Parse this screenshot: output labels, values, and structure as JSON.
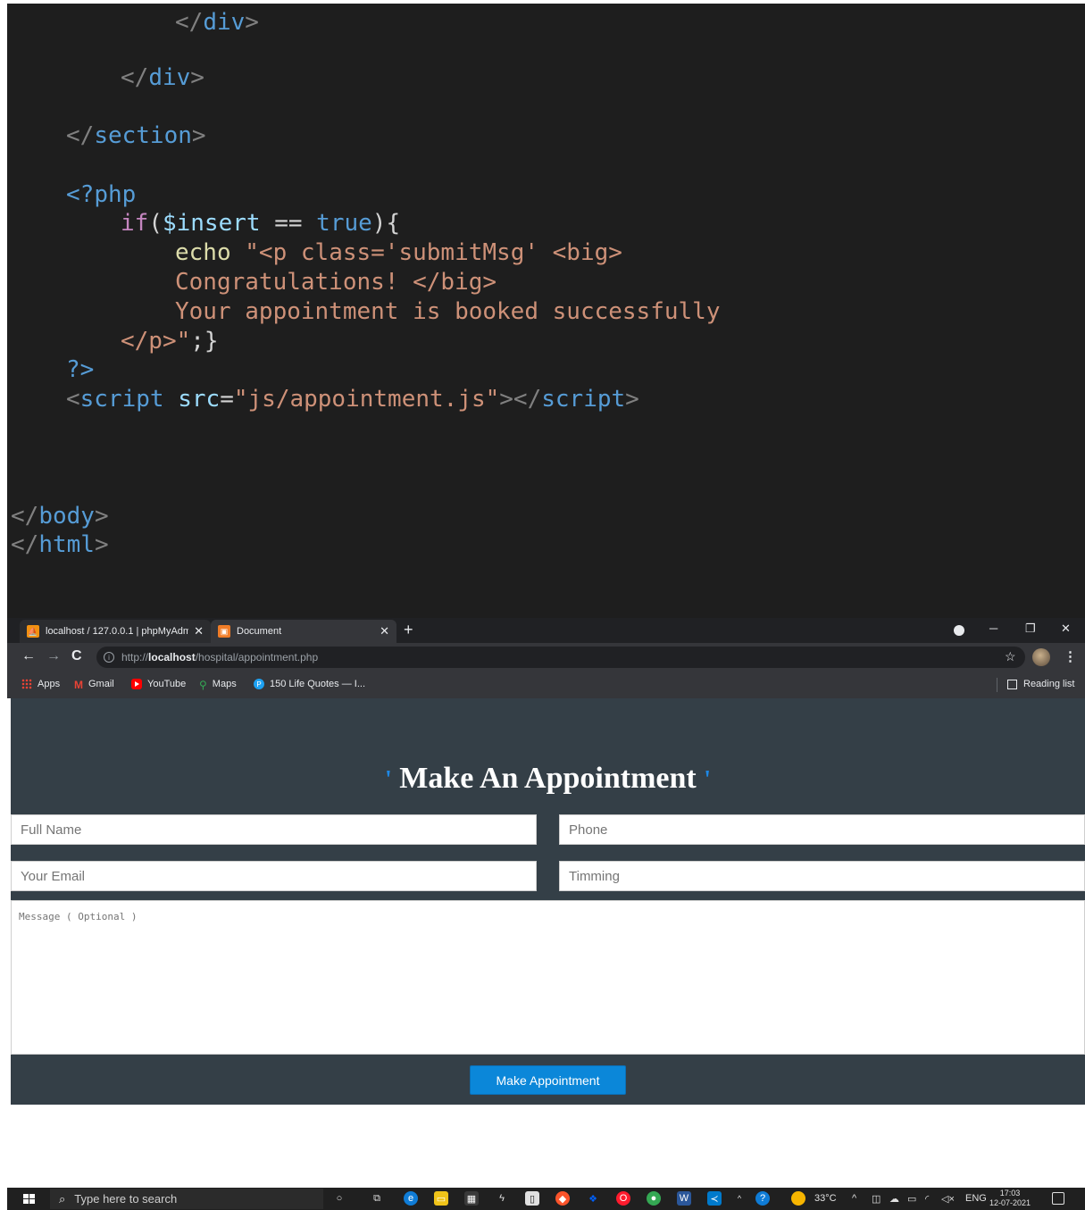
{
  "editor": {
    "lines": {
      "l1": {
        "close": "</",
        "tag": "div",
        "end": ">"
      },
      "l2": {
        "close": "</",
        "tag": "div",
        "end": ">"
      },
      "l3": {
        "close": "</",
        "tag": "section",
        "end": ">"
      },
      "l4": {
        "open": "<?",
        "tag": "php"
      },
      "l5": {
        "kw": "if",
        "p1": "(",
        "var": "$insert",
        "op": " == ",
        "bool": "true",
        "p2": "){"
      },
      "l6": {
        "fn": "echo",
        "str": " \"<p class='submitMsg' <big>"
      },
      "l7": {
        "str": "Congratulations! </big>"
      },
      "l8": {
        "str": "Your appointment is booked successfully"
      },
      "l9": {
        "str": "</p>\"",
        "rest": ";}"
      },
      "l10": {
        "php": "?>"
      },
      "l11": {
        "open": "<",
        "tag": "script",
        "attr": " src",
        "eq": "=",
        "str": "\"js/appointment.js\"",
        "mid": "></",
        "tag2": "script",
        "end": ">"
      },
      "l12": {
        "close": "</",
        "tag": "body",
        "end": ">"
      },
      "l13": {
        "close": "</",
        "tag": "html",
        "end": ">"
      }
    }
  },
  "browser": {
    "tabs": [
      {
        "title": "localhost / 127.0.0.1 | phpMyAdm",
        "close": "✕",
        "icon": "phpmyadmin-icon"
      },
      {
        "title": "Document",
        "close": "✕",
        "icon": "document-icon"
      }
    ],
    "new_tab": "+",
    "window_controls": {
      "minimize": "─",
      "restore": "❐",
      "close": "✕"
    },
    "nav": {
      "back": "←",
      "forward": "→",
      "reload": "C"
    },
    "url": {
      "scheme": "http://",
      "host": "localhost",
      "path": "/hospital/appointment.php"
    },
    "info_glyph": "i",
    "star": "☆",
    "menu": "⋮",
    "bookmarks": [
      {
        "label": "Apps"
      },
      {
        "label": "Gmail",
        "glyph": "M"
      },
      {
        "label": "YouTube"
      },
      {
        "label": "Maps",
        "glyph": "⚲"
      },
      {
        "label": "150 Life Quotes — I...",
        "glyph": "P"
      }
    ],
    "reading_list": "Reading list"
  },
  "page": {
    "quote_left": "'",
    "quote_right": "'",
    "heading": "Make An Appointment",
    "fields": {
      "full_name": {
        "placeholder": "Full Name",
        "value": ""
      },
      "phone": {
        "placeholder": "Phone",
        "value": ""
      },
      "email": {
        "placeholder": "Your Email",
        "value": ""
      },
      "timing": {
        "placeholder": "Timming",
        "value": ""
      },
      "message": {
        "placeholder": "Message ( Optional )",
        "value": ""
      }
    },
    "submit_label": "Make Appointment"
  },
  "taskbar": {
    "search_placeholder": "Type here to search",
    "weather": "33°C",
    "language": "ENG",
    "time": "17:03",
    "date": "12-07-2021"
  }
}
